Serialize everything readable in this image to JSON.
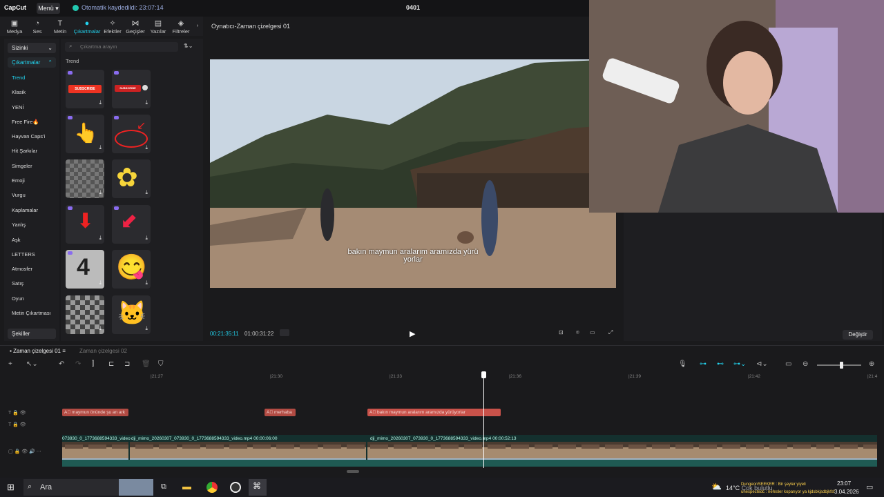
{
  "app": {
    "logo": "CapCut",
    "menu_label": "Menü",
    "autosave": "Otomatik kaydedildi: 23:07:14",
    "project_title": "0401"
  },
  "toolbar": {
    "tools": [
      {
        "label": "Medya",
        "icon": "media-icon"
      },
      {
        "label": "Ses",
        "icon": "audio-icon"
      },
      {
        "label": "Metin",
        "icon": "text-icon"
      },
      {
        "label": "Çıkartmalar",
        "icon": "sticker-icon"
      },
      {
        "label": "Efektler",
        "icon": "effects-icon"
      },
      {
        "label": "Geçişler",
        "icon": "transitions-icon"
      },
      {
        "label": "Yazılar",
        "icon": "captions-icon"
      },
      {
        "label": "Filtreler",
        "icon": "filters-icon"
      }
    ],
    "active_tool": "Çıkartmalar"
  },
  "sidebar": {
    "dropdown_top": "Sizinki",
    "dropdown_active": "Çıkartmalar",
    "categories": [
      "Trend",
      "Klasik",
      "YENİ",
      "Free Fire🔥",
      "Hayvan Caps'i",
      "Hit Şarkılar",
      "Simgeler",
      "Emoji",
      "Vurgu",
      "Kaplamalar",
      "Yanlış",
      "Aşk",
      "LETTERS",
      "Atmosfer",
      "Satış",
      "Oyun",
      "Metin Çıkartması"
    ],
    "active_category": "Trend",
    "bottom_dropdown": "Şekiller"
  },
  "stickers": {
    "search_placeholder": "Çıkartma arayın",
    "section_label": "Trend",
    "subscribe_text": "SUBSCRIBE",
    "countdown_digit": "4"
  },
  "player": {
    "title": "Oynatıcı-Zaman çizelgesi 01",
    "subtitle_line1": "bakın maymun aralarım aramızda yürü",
    "subtitle_line2": "yorlar",
    "current_time": "00:21:35:11",
    "total_time": "01:00:31:22"
  },
  "properties": {
    "change_button": "Değiştir"
  },
  "timeline": {
    "tab_active": "Zaman çizelgesi 01",
    "tab_other": "Zaman çizelgesi 02",
    "ruler_labels": [
      "|21:27",
      "|21:30",
      "|21:33",
      "|21:36",
      "|21:39",
      "|21:42",
      "|21:4"
    ],
    "text_clips": [
      {
        "label": "maymun önünde şu an ark"
      },
      {
        "label": "merhaba"
      },
      {
        "label": "bakın maymun aralarım aramızda yürüyorlar"
      }
    ],
    "video_clips": [
      {
        "label": "073930_0_1773688594333_video"
      },
      {
        "label": "dji_mimo_20260307_073930_0_1773688594333_video.mp4   00:00:06:00"
      },
      {
        "label": "dji_mimo_20260307_073930_0_1773688594333_video.mp4   00:00:52:13"
      }
    ]
  },
  "taskbar": {
    "search_label": "Ara",
    "weather": "14°C",
    "weather_text": "Çok bulutlu",
    "notif1": "DungeonSEEKER : Bir şeyler yiyeli",
    "notif2": "unexpectedc : nefesler koparıyor ya kjdsbkjsdbjkfsf",
    "time": "23:07",
    "date": "3.04.2026"
  },
  "colors": {
    "accent": "#22d3ee",
    "text_clip": "#b24b43",
    "video_track": "#14302e"
  }
}
